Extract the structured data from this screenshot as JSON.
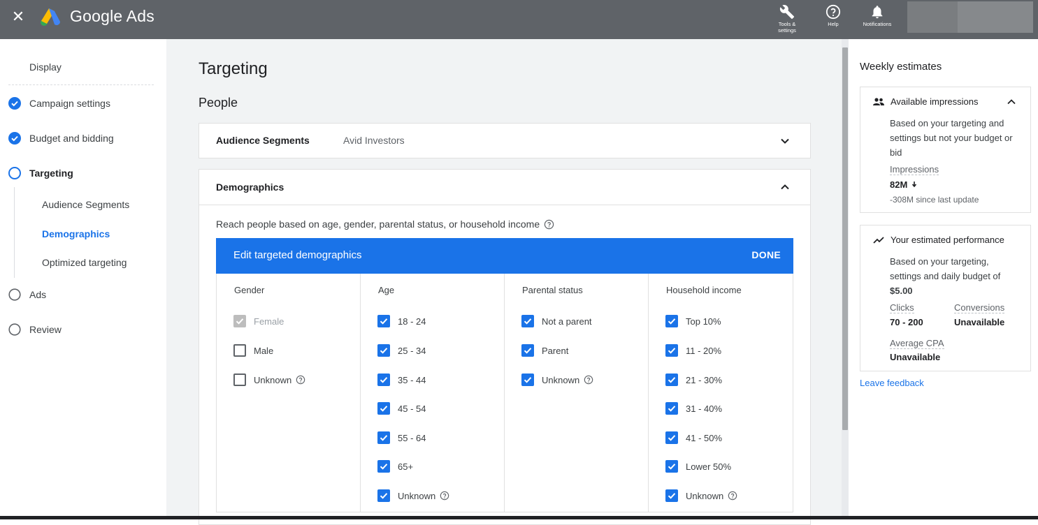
{
  "topbar": {
    "brand": "Google Ads",
    "tools_label": "Tools & settings",
    "help_label": "Help",
    "notifications_label": "Notifications"
  },
  "sidebar": {
    "display_label": "Display",
    "items": [
      {
        "label": "Campaign settings",
        "state": "done"
      },
      {
        "label": "Budget and bidding",
        "state": "done"
      },
      {
        "label": "Targeting",
        "state": "current"
      },
      {
        "label": "Ads",
        "state": "todo"
      },
      {
        "label": "Review",
        "state": "todo"
      }
    ],
    "sub_items": [
      {
        "label": "Audience Segments",
        "active": false
      },
      {
        "label": "Demographics",
        "active": true
      },
      {
        "label": "Optimized targeting",
        "active": false
      }
    ]
  },
  "main": {
    "title": "Targeting",
    "section": "People",
    "audience_card": {
      "heading": "Audience Segments",
      "value": "Avid Investors"
    },
    "demographics_card": {
      "heading": "Demographics",
      "description": "Reach people based on age, gender, parental status, or household income",
      "edit_title": "Edit targeted demographics",
      "done_label": "DONE",
      "columns": [
        {
          "title": "Gender",
          "options": [
            {
              "label": "Female",
              "state": "disabled",
              "help": false
            },
            {
              "label": "Male",
              "state": "unchecked",
              "help": false
            },
            {
              "label": "Unknown",
              "state": "unchecked",
              "help": true
            }
          ]
        },
        {
          "title": "Age",
          "options": [
            {
              "label": "18 - 24",
              "state": "checked",
              "help": false
            },
            {
              "label": "25 - 34",
              "state": "checked",
              "help": false
            },
            {
              "label": "35 - 44",
              "state": "checked",
              "help": false
            },
            {
              "label": "45 - 54",
              "state": "checked",
              "help": false
            },
            {
              "label": "55 - 64",
              "state": "checked",
              "help": false
            },
            {
              "label": "65+",
              "state": "checked",
              "help": false
            },
            {
              "label": "Unknown",
              "state": "checked",
              "help": true
            }
          ]
        },
        {
          "title": "Parental status",
          "options": [
            {
              "label": "Not a parent",
              "state": "checked",
              "help": false
            },
            {
              "label": "Parent",
              "state": "checked",
              "help": false
            },
            {
              "label": "Unknown",
              "state": "checked",
              "help": true
            }
          ]
        },
        {
          "title": "Household income",
          "options": [
            {
              "label": "Top 10%",
              "state": "checked",
              "help": false
            },
            {
              "label": "11 - 20%",
              "state": "checked",
              "help": false
            },
            {
              "label": "21 - 30%",
              "state": "checked",
              "help": false
            },
            {
              "label": "31 - 40%",
              "state": "checked",
              "help": false
            },
            {
              "label": "41 - 50%",
              "state": "checked",
              "help": false
            },
            {
              "label": "Lower 50%",
              "state": "checked",
              "help": false
            },
            {
              "label": "Unknown",
              "state": "checked",
              "help": true
            }
          ]
        }
      ]
    }
  },
  "estimates": {
    "title": "Weekly estimates",
    "impressions_card": {
      "heading": "Available impressions",
      "body": "Based on your targeting and settings but not your budget or bid",
      "label": "Impressions",
      "value": "82M",
      "change": "-308M since last update"
    },
    "performance_card": {
      "heading": "Your estimated performance",
      "body": "Based on your targeting, settings and daily budget of",
      "budget": "$5.00",
      "clicks_label": "Clicks",
      "clicks_value": "70 - 200",
      "conversions_label": "Conversions",
      "conversions_value": "Unavailable",
      "cpa_label": "Average CPA",
      "cpa_value": "Unavailable"
    },
    "feedback_label": "Leave feedback"
  },
  "colors": {
    "accent": "#1a73e8",
    "topbar": "#5f6368",
    "background": "#f1f3f4"
  }
}
